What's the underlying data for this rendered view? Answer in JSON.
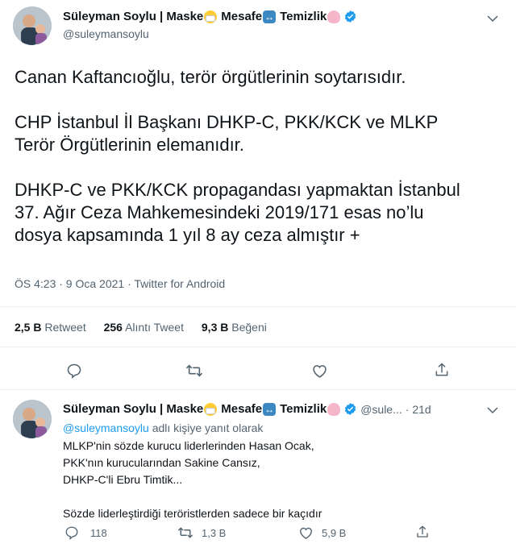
{
  "main_tweet": {
    "author_name": "Süleyman Soylu | Maske",
    "name_part2": "Mesafe",
    "name_part3": "Temizlik",
    "handle": "@suleymansoylu",
    "text_p1": "Canan Kaftancıoğlu, terör örgütlerinin soytarısıdır.",
    "text_p2_l1": "CHP İstanbul İl Başkanı DHKP-C, PKK/KCK ve MLKP",
    "text_p2_l2": "Terör Örgütlerinin elemanıdır.",
    "text_p3_l1": "DHKP-C ve PKK/KCK propagandası yapmaktan İstanbul",
    "text_p3_l2": "37. Ağır Ceza Mahkemesindeki 2019/171 esas no’lu",
    "text_p3_l3": "dosya kapsamında 1 yıl 8 ay ceza almıştır +",
    "timestamp": "ÖS 4:23 · 9 Oca 2021 · Twitter for Android",
    "stats": {
      "retweets": "2,5 B",
      "retweets_label": "Retweet",
      "quotes": "256",
      "quotes_label": "Alıntı Tweet",
      "likes": "9,3 B",
      "likes_label": "Beğeni"
    }
  },
  "reply_tweet": {
    "author_name": "Süleyman Soylu | Maske",
    "name_part2": "Mesafe",
    "name_part3": "Temizlik",
    "handle": "@sule...",
    "time": "· 21d",
    "reply_to_handle": "@suleymansoylu",
    "reply_to_suffix": " adlı kişiye yanıt olarak",
    "line1": "MLKP'nin sözde kurucu liderlerinden Hasan Ocak,",
    "line2": "PKK'nın kurucularından Sakine Cansız,",
    "line3": "DHKP-C'li Ebru Timtik...",
    "line4": "Sözde liderleştirdiği teröristlerden sadece bir kaçıdır",
    "reply_count": "118",
    "retweet_count": "1,3 B",
    "like_count": "5,9 B"
  },
  "icons": [
    "avatar",
    "verified-badge",
    "chevron-down-icon",
    "reply-icon",
    "retweet-icon",
    "like-icon",
    "share-icon"
  ],
  "colors": {
    "accent": "#1d9bf0",
    "muted": "#536471",
    "divider": "#e6ecf0"
  }
}
